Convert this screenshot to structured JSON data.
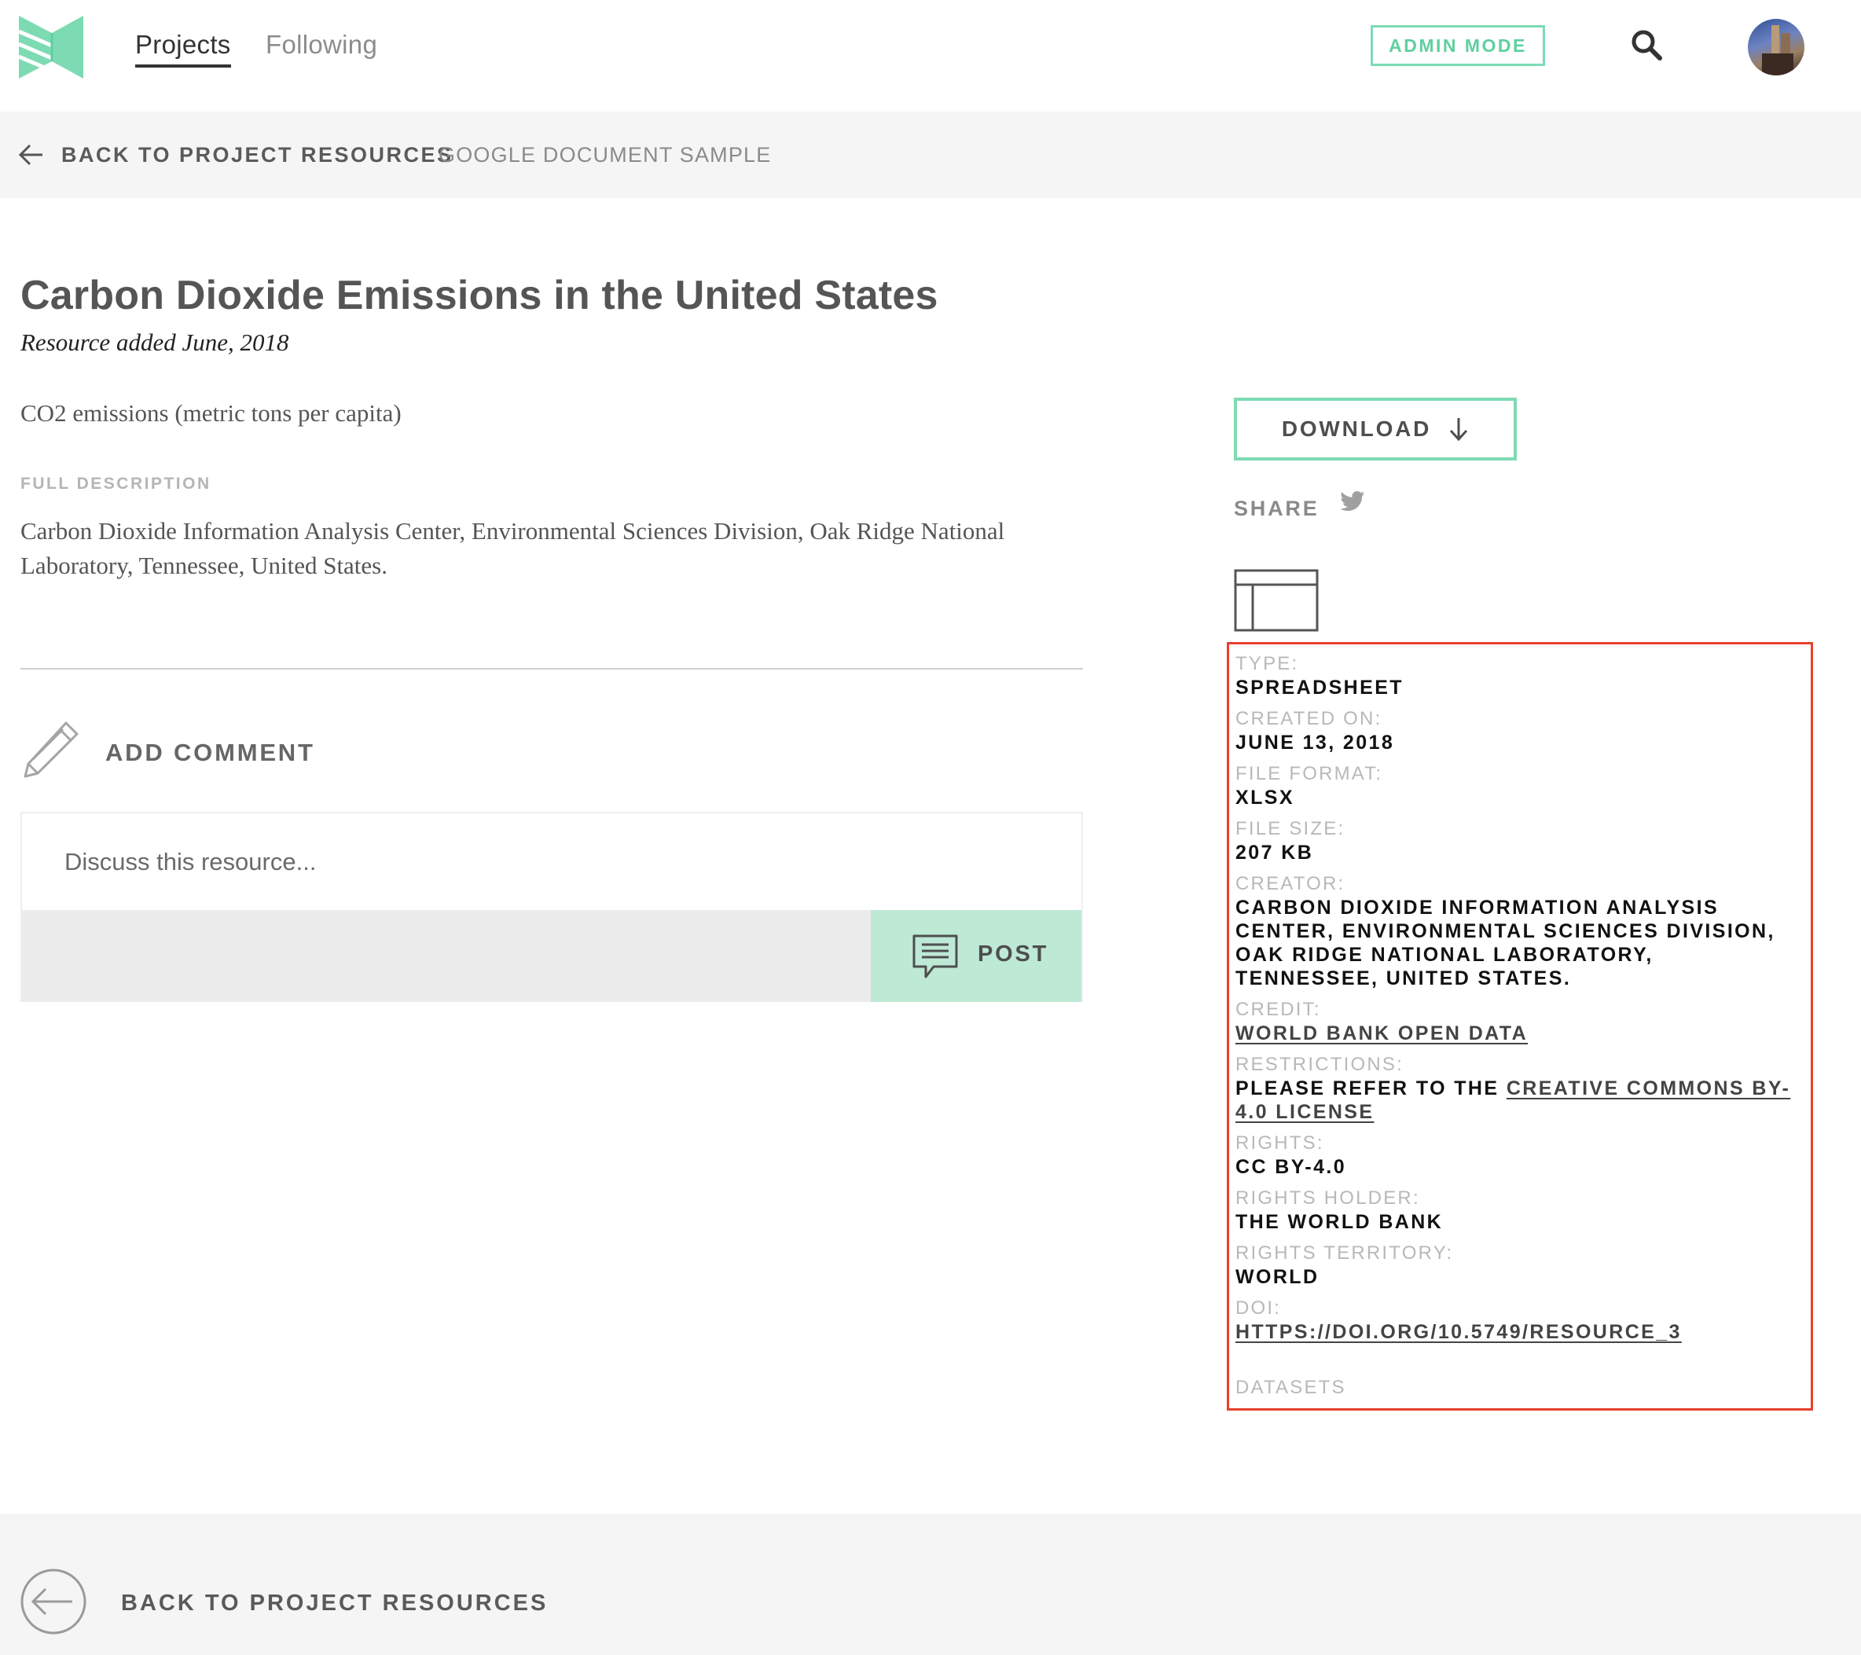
{
  "nav": {
    "projects": "Projects",
    "following": "Following",
    "admin_mode": "ADMIN MODE"
  },
  "breadcrumb": {
    "back": "BACK TO PROJECT RESOURCES",
    "current": "GOOGLE DOCUMENT SAMPLE"
  },
  "resource": {
    "title": "Carbon Dioxide Emissions in the United States",
    "added": "Resource added June, 2018",
    "subtitle": "CO2 emissions (metric tons per capita)",
    "full_description_label": "FULL DESCRIPTION",
    "full_description": "Carbon Dioxide Information Analysis Center, Environmental Sciences Division, Oak Ridge National Laboratory, Tennessee, United States."
  },
  "comment": {
    "heading": "ADD COMMENT",
    "placeholder": "Discuss this resource...",
    "post": "POST"
  },
  "actions": {
    "download": "DOWNLOAD",
    "share": "SHARE"
  },
  "meta": {
    "type_label": "TYPE:",
    "type": "SPREADSHEET",
    "created_label": "CREATED ON:",
    "created": "JUNE 13, 2018",
    "format_label": "FILE FORMAT:",
    "format": "XLSX",
    "size_label": "FILE SIZE:",
    "size": "207 KB",
    "creator_label": "CREATOR:",
    "creator": "CARBON DIOXIDE INFORMATION ANALYSIS CENTER, ENVIRONMENTAL SCIENCES DIVISION, OAK RIDGE NATIONAL LABORATORY, TENNESSEE, UNITED STATES.",
    "credit_label": "CREDIT:",
    "credit": "WORLD BANK OPEN DATA",
    "restrictions_label": "RESTRICTIONS:",
    "restrictions_prefix": "PLEASE REFER TO THE ",
    "restrictions_link": "CREATIVE COMMONS BY-4.0 LICENSE",
    "rights_label": "RIGHTS:",
    "rights": "CC BY-4.0",
    "rights_holder_label": "RIGHTS HOLDER:",
    "rights_holder": "THE WORLD BANK",
    "territory_label": "RIGHTS TERRITORY:",
    "territory": "WORLD",
    "doi_label": "DOI:",
    "doi": "HTTPS://DOI.ORG/10.5749/RESOURCE_3",
    "datasets_label": "DATASETS"
  },
  "footer": {
    "back": "BACK TO PROJECT RESOURCES"
  },
  "colors": {
    "accent": "#7ddbb4",
    "post_bg": "#bde9d5",
    "highlight_box": "#e8402f",
    "bar_bg": "#f5f5f5"
  },
  "icons": {
    "logo": "book-logo-icon",
    "search": "search-icon",
    "back": "arrow-left-icon",
    "comment": "pencil-icon",
    "post": "chat-bubble-icon",
    "download": "arrow-down-icon",
    "share": "twitter-icon",
    "type": "spreadsheet-icon",
    "footer_back": "circle-arrow-left-icon"
  }
}
